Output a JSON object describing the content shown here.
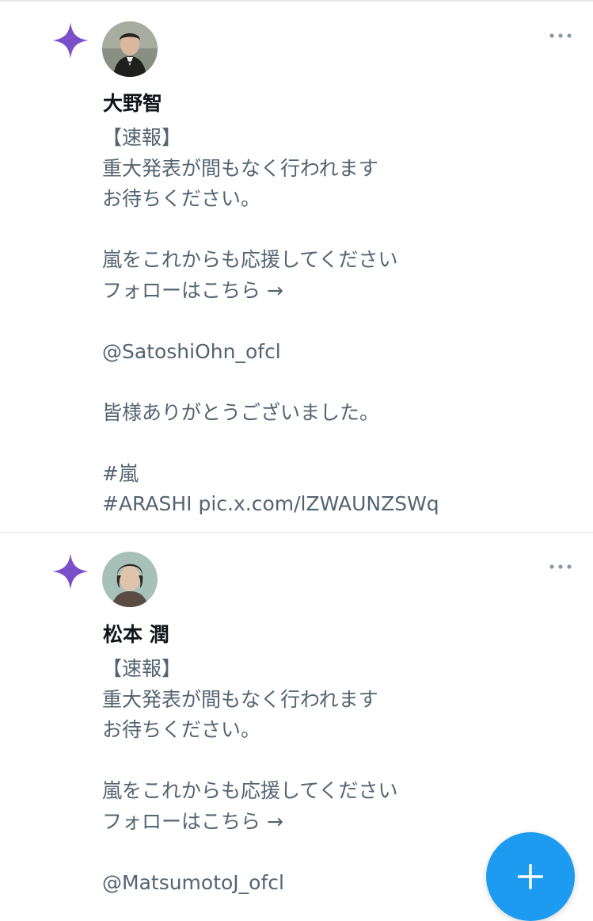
{
  "posts": [
    {
      "name": "大野智",
      "lines": [
        "【速報】",
        "重大発表が間もなく行われます",
        "お待ちください。",
        "",
        "嵐をこれからも応援してください",
        "フォローはこちら →",
        "",
        "@SatoshiOhn_ofcl",
        "",
        "皆様ありがとうございました。",
        "",
        "#嵐",
        "#ARASHI pic.x.com/lZWAUNZSWq"
      ]
    },
    {
      "name": "松本 潤",
      "lines": [
        "【速報】",
        "重大発表が間もなく行われます",
        "お待ちください。",
        "",
        "嵐をこれからも応援してください",
        "フォローはこちら →",
        "",
        "@MatsumotoJ_ofcl"
      ]
    }
  ],
  "icons": {
    "sparkle": "sparkle-icon",
    "more": "more-horizontal-icon",
    "compose": "plus-icon"
  },
  "colors": {
    "sparkle": "#7b4fc9",
    "text": "#536471",
    "name": "#0f1419",
    "fab": "#1d9bf0",
    "divider": "#dfe3e7"
  }
}
